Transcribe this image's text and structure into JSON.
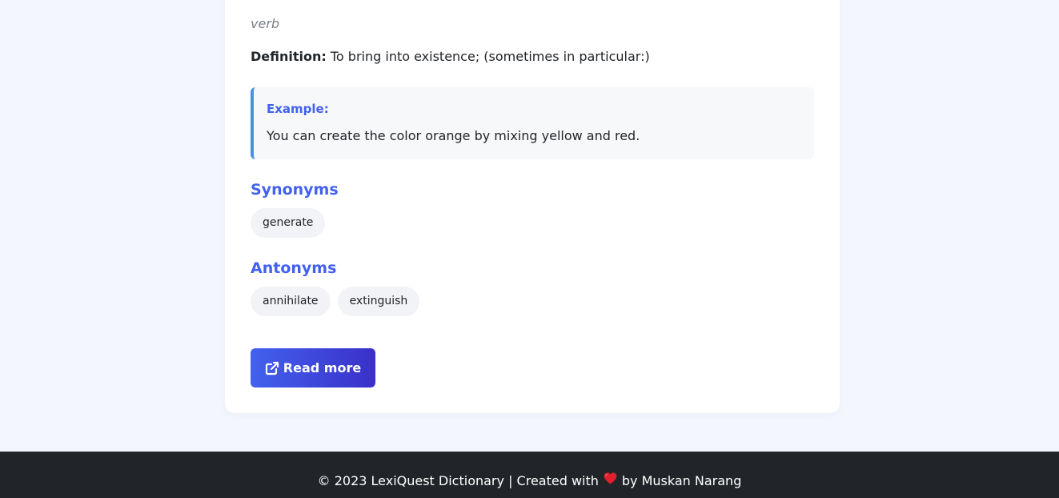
{
  "entry": {
    "part_of_speech": "verb",
    "definition_label": "Definition:",
    "definition_text": "To bring into existence; (sometimes in particular:)",
    "example_label": "Example:",
    "example_text": "You can create the color orange by mixing yellow and red."
  },
  "synonyms": {
    "title": "Synonyms",
    "items": [
      "generate"
    ]
  },
  "antonyms": {
    "title": "Antonyms",
    "items": [
      "annihilate",
      "extinguish"
    ]
  },
  "read_more": {
    "label": "Read more",
    "icon": "external-link-icon"
  },
  "footer": {
    "text_before": "© 2023 LexiQuest Dictionary | Created with",
    "heart_icon": "heart-icon",
    "text_after": "by Muskan Narang"
  },
  "colors": {
    "accent": "#4361ee",
    "example_border": "#4a90e2",
    "footer_bg": "#212529",
    "page_bg": "#f3f6fd",
    "heart": "#e0212b"
  }
}
